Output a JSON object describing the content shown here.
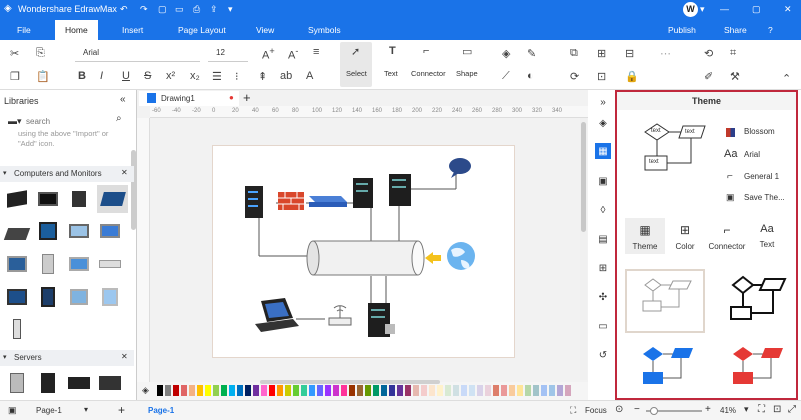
{
  "app": {
    "title": "Wondershare EdrawMax",
    "publish": "Publish",
    "share": "Share",
    "avatar_letter": "W"
  },
  "menu": {
    "items": [
      "File",
      "Home",
      "Insert",
      "Page Layout",
      "View",
      "Symbols"
    ],
    "active": "Home"
  },
  "ribbon": {
    "font": "Arial",
    "size": "12",
    "tools": [
      "Select",
      "Text",
      "Connector",
      "Shape"
    ]
  },
  "libraries": {
    "title": "Libraries",
    "search_placeholder": "search",
    "hint": "using the above \"Import\" or \"Add\" icon.",
    "sections": [
      "Computers and Monitors",
      "Servers"
    ]
  },
  "document": {
    "tab": "Drawing1",
    "ruler_ticks": [
      "-60",
      "-40",
      "-20",
      "0",
      "20",
      "40",
      "60",
      "80",
      "100",
      "120",
      "140",
      "160",
      "180",
      "200",
      "220",
      "240",
      "260",
      "280",
      "300",
      "320",
      "340"
    ]
  },
  "diagram": {
    "bubble_text": "",
    "palette_colors": [
      "#000000",
      "#7f7f7f",
      "#c00000",
      "#e06666",
      "#f4b183",
      "#ffc000",
      "#ffff00",
      "#92d050",
      "#00b050",
      "#00b0f0",
      "#0070c0",
      "#002060",
      "#7030a0",
      "#ff66cc",
      "#ff0000",
      "#ff9900",
      "#cccc00",
      "#66cc33",
      "#33cc99",
      "#3399ff",
      "#6666ff",
      "#9933ff",
      "#cc33cc",
      "#ff3399",
      "#993300",
      "#996633",
      "#669900",
      "#009966",
      "#006699",
      "#333399",
      "#663399",
      "#993366",
      "#e6b8af",
      "#f4cccc",
      "#fce5cd",
      "#fff2cc",
      "#d9ead3",
      "#d0e0e3",
      "#c9daf8",
      "#cfe2f3",
      "#d9d2e9",
      "#ead1dc",
      "#dd7e6b",
      "#ea9999",
      "#f9cb9c",
      "#ffe599",
      "#b6d7a8",
      "#a2c4c9",
      "#a4c2f4",
      "#9fc5e8",
      "#b4a7d6",
      "#d5a6bd"
    ]
  },
  "theme_panel": {
    "title": "Theme",
    "preview_labels": [
      "text",
      "text",
      "text"
    ],
    "options": [
      "Blossom",
      "Arial",
      "General 1",
      "Save The..."
    ],
    "tabs": [
      "Theme",
      "Color",
      "Connector",
      "Text"
    ]
  },
  "status": {
    "page_selector": "Page-1",
    "page_tab": "Page-1",
    "focus": "Focus",
    "zoom": "41%"
  }
}
